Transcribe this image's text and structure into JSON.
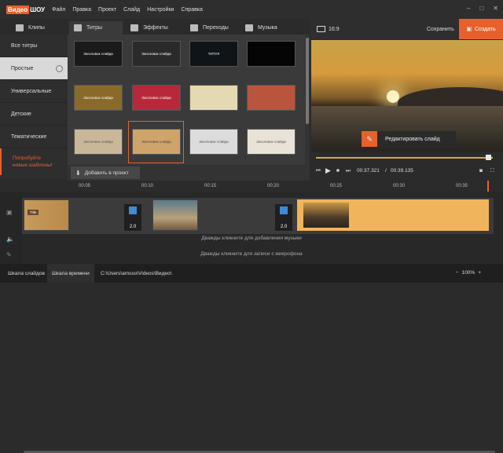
{
  "app": {
    "logo_part1": "Видео",
    "logo_part2": "ШОУ"
  },
  "menu": [
    "Файл",
    "Правка",
    "Проект",
    "Слайд",
    "Настройки",
    "Справка"
  ],
  "window_controls": {
    "minimize": "–",
    "maximize": "□",
    "close": "✕"
  },
  "tabs": [
    {
      "label": "Клипы"
    },
    {
      "label": "Титры"
    },
    {
      "label": "Эффекты"
    },
    {
      "label": "Переходы"
    },
    {
      "label": "Музыка"
    }
  ],
  "categories": [
    {
      "label": "Все титры"
    },
    {
      "label": "Простые"
    },
    {
      "label": "Универсальные"
    },
    {
      "label": "Детские"
    },
    {
      "label": "Тематические"
    }
  ],
  "promo_line1": "Попробуйте",
  "promo_line2": "новые шаблоны!",
  "thumbnails": [
    {
      "text": "Заголовок слайда",
      "color": "#1a1a1a"
    },
    {
      "text": "Заголовок слайда",
      "color": "#2a2a2a"
    },
    {
      "text": "ТИТУЛ",
      "color": "#0e1418"
    },
    {
      "text": "",
      "color": "#050505"
    },
    {
      "text": "Заголовок слайда",
      "color": "#8a6a2a"
    },
    {
      "text": "Заголовок слайда",
      "color": "#b8283a"
    },
    {
      "text": "",
      "color": "#e4d9b0"
    },
    {
      "text": "",
      "color": "#b9553c"
    },
    {
      "text": "Заголовок слайда",
      "color": "#c9b79a"
    },
    {
      "text": "Заголовок слайда",
      "color": "#cfa46a"
    },
    {
      "text": "Заголовок слайда",
      "color": "#dcdcdc"
    },
    {
      "text": "Заголовок слайда",
      "color": "#e9e2d6"
    }
  ],
  "add_to_project": "Добавить в проект",
  "aspect_ratio": "16:9",
  "save_label": "Сохранить",
  "create_label": "Создать",
  "edit_slide_label": "Редактировать слайд",
  "time_current": "00:37.321",
  "time_sep": "/",
  "time_total": "00:39.135",
  "ruler_ticks": [
    "00:05",
    "00:10",
    "00:15",
    "00:20",
    "00:25",
    "00:30",
    "00:35"
  ],
  "transition_durations": [
    "2.0",
    "2.0"
  ],
  "clip1_title": "Title",
  "music_hint": "Дважды кликните для добавления музыки",
  "mic_hint": "Дважды кликните для записи с микрофона",
  "bottom": {
    "tab_slides": "Шкала слайдов",
    "tab_timeline": "Шкала времени",
    "path": "C:\\Users\\amsso\\Videos\\Видео\\",
    "zoom": "100%",
    "zoom_minus": "−",
    "zoom_plus": "+"
  },
  "colors": {
    "accent": "#e8612c",
    "timeline_select": "#f0b55c",
    "transition_icon": "#3f8bd8"
  }
}
